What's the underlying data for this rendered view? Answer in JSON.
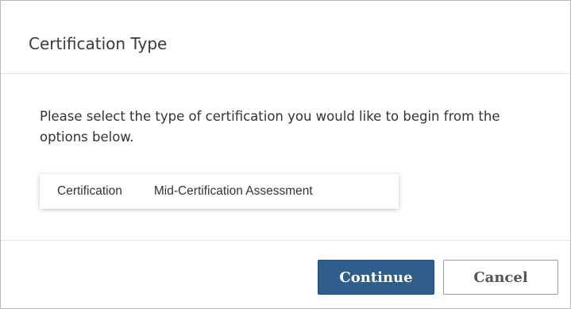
{
  "dialog": {
    "title": "Certification Type",
    "message": "Please select the type of certification you would like to begin from the options below.",
    "options": [
      {
        "label": "Certification"
      },
      {
        "label": "Mid-Certification Assessment"
      }
    ],
    "buttons": {
      "continue_label": "Continue",
      "cancel_label": "Cancel"
    }
  },
  "colors": {
    "primary_button": "#2f5e8c",
    "text": "#333333",
    "border": "#b9b9b9"
  }
}
